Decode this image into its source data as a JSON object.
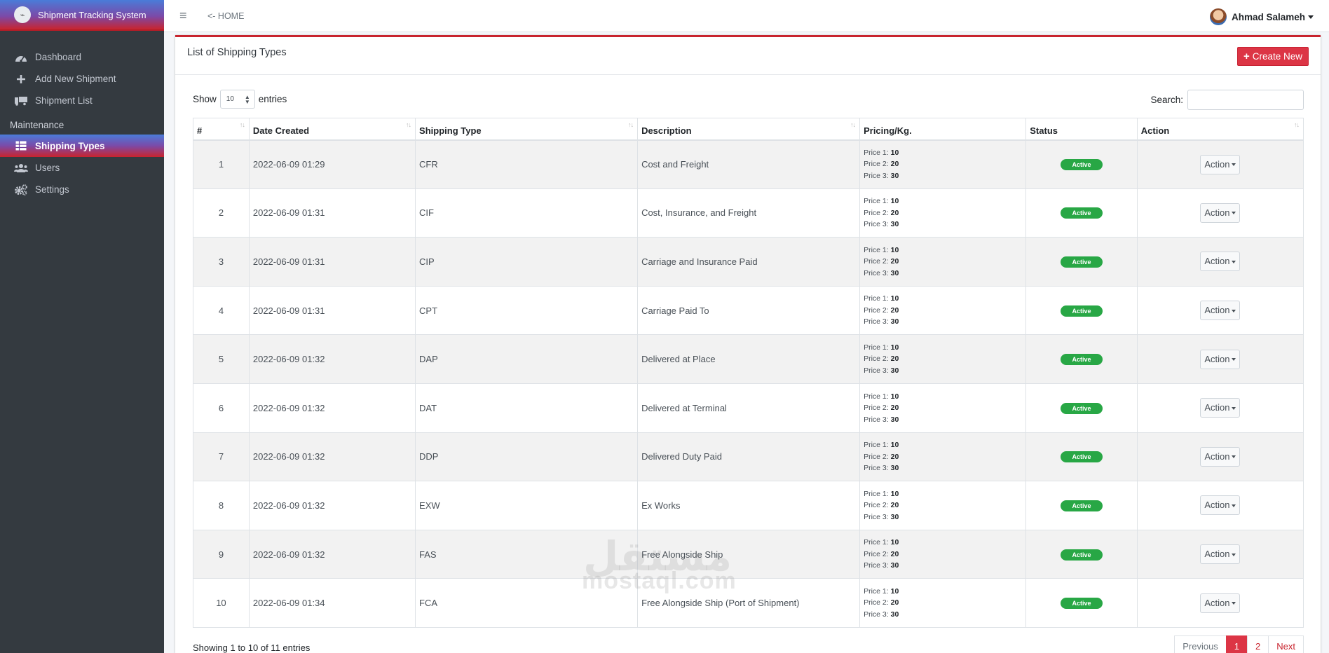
{
  "brand": {
    "title": "Shipment Tracking System"
  },
  "topbar": {
    "home_link": "<- HOME",
    "user_name": "Ahmad Salameh"
  },
  "sidebar": {
    "items": [
      {
        "label": "Dashboard",
        "icon": "dashboard-icon"
      },
      {
        "label": "Add New Shipment",
        "icon": "plus-icon"
      },
      {
        "label": "Shipment List",
        "icon": "truck-icon"
      }
    ],
    "section_header": "Maintenance",
    "maintenance_items": [
      {
        "label": "Shipping Types",
        "icon": "table-icon",
        "active": true
      },
      {
        "label": "Users",
        "icon": "users-icon"
      },
      {
        "label": "Settings",
        "icon": "gears-icon"
      }
    ]
  },
  "card": {
    "title": "List of Shipping Types",
    "create_label": "Create New"
  },
  "controls": {
    "show_label": "Show",
    "entries_value": "10",
    "entries_label": "entries",
    "search_label": "Search:"
  },
  "table": {
    "columns": [
      "#",
      "Date Created",
      "Shipping Type",
      "Description",
      "Pricing/Kg.",
      "Status",
      "Action"
    ],
    "price_labels": [
      "Price 1:",
      "Price 2:",
      "Price 3:"
    ],
    "rows": [
      {
        "num": "1",
        "date": "2022-06-09 01:29",
        "type": "CFR",
        "desc": "Cost and Freight",
        "prices": [
          "10",
          "20",
          "30"
        ],
        "status": "Active",
        "action": "Action"
      },
      {
        "num": "2",
        "date": "2022-06-09 01:31",
        "type": "CIF",
        "desc": "Cost, Insurance, and Freight",
        "prices": [
          "10",
          "20",
          "30"
        ],
        "status": "Active",
        "action": "Action"
      },
      {
        "num": "3",
        "date": "2022-06-09 01:31",
        "type": "CIP",
        "desc": "Carriage and Insurance Paid",
        "prices": [
          "10",
          "20",
          "30"
        ],
        "status": "Active",
        "action": "Action"
      },
      {
        "num": "4",
        "date": "2022-06-09 01:31",
        "type": "CPT",
        "desc": "Carriage Paid To",
        "prices": [
          "10",
          "20",
          "30"
        ],
        "status": "Active",
        "action": "Action"
      },
      {
        "num": "5",
        "date": "2022-06-09 01:32",
        "type": "DAP",
        "desc": "Delivered at Place",
        "prices": [
          "10",
          "20",
          "30"
        ],
        "status": "Active",
        "action": "Action"
      },
      {
        "num": "6",
        "date": "2022-06-09 01:32",
        "type": "DAT",
        "desc": "Delivered at Terminal",
        "prices": [
          "10",
          "20",
          "30"
        ],
        "status": "Active",
        "action": "Action"
      },
      {
        "num": "7",
        "date": "2022-06-09 01:32",
        "type": "DDP",
        "desc": "Delivered Duty Paid",
        "prices": [
          "10",
          "20",
          "30"
        ],
        "status": "Active",
        "action": "Action"
      },
      {
        "num": "8",
        "date": "2022-06-09 01:32",
        "type": "EXW",
        "desc": "Ex Works",
        "prices": [
          "10",
          "20",
          "30"
        ],
        "status": "Active",
        "action": "Action"
      },
      {
        "num": "9",
        "date": "2022-06-09 01:32",
        "type": "FAS",
        "desc": "Free Alongside Ship",
        "prices": [
          "10",
          "20",
          "30"
        ],
        "status": "Active",
        "action": "Action"
      },
      {
        "num": "10",
        "date": "2022-06-09 01:34",
        "type": "FCA",
        "desc": "Free Alongside Ship (Port of Shipment)",
        "prices": [
          "10",
          "20",
          "30"
        ],
        "status": "Active",
        "action": "Action"
      }
    ]
  },
  "footer": {
    "info": "Showing 1 to 10 of 11 entries",
    "pagination": {
      "previous": "Previous",
      "pages": [
        "1",
        "2"
      ],
      "current": "1",
      "next": "Next"
    }
  },
  "watermark": {
    "arabic": "مستقل",
    "latin": "mostaql.com"
  },
  "colors": {
    "accent": "#dc3545",
    "sidebar_bg": "#343a40",
    "status_active": "#28a745"
  }
}
